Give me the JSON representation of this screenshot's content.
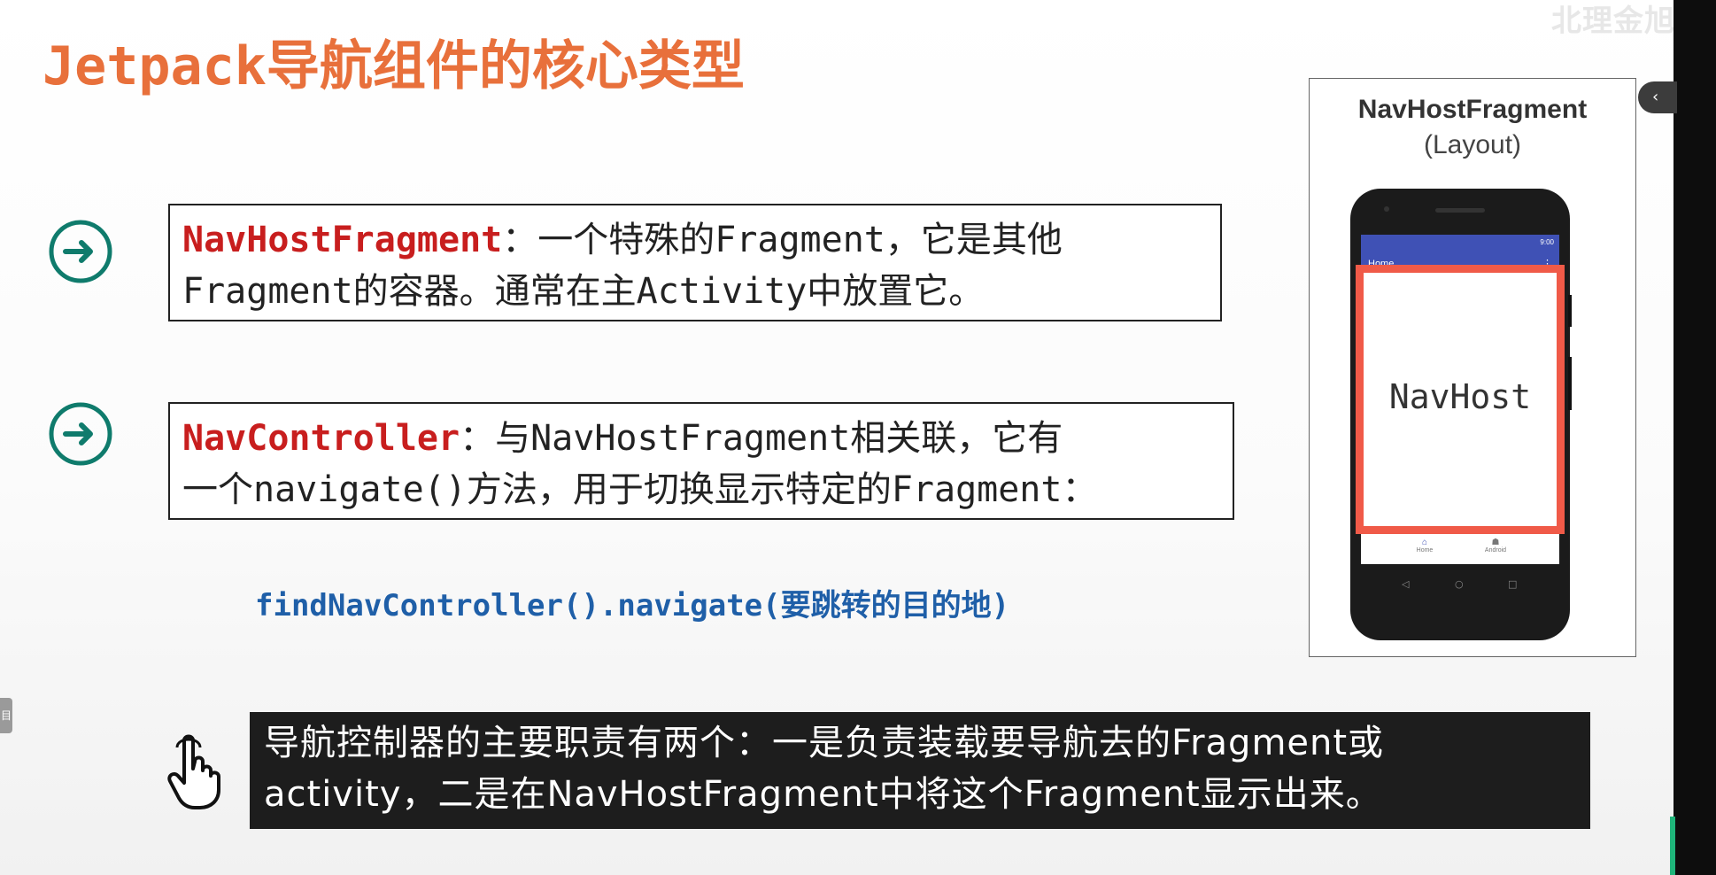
{
  "watermark": "北理金旭亮",
  "title": {
    "latin": "Jetpack",
    "chinese": "导航组件的核心类型"
  },
  "items": [
    {
      "term": "NavHostFragment",
      "line1_rest": "：一个特殊的Fragment，它是其他",
      "line2": "Fragment的容器。通常在主Activity中放置它。"
    },
    {
      "term": "NavController",
      "line1_rest": "：与NavHostFragment相关联，它有",
      "line2": "一个navigate()方法，用于切换显示特定的Fragment："
    }
  ],
  "code": "findNavController().navigate(要跳转的目的地)",
  "caption": {
    "line1": "导航控制器的主要职责有两个：一是负责装载要导航去的Fragment或",
    "line2": "activity，二是在NavHostFragment中将这个Fragment显示出来。"
  },
  "phone": {
    "title": "NavHostFragment",
    "subtitle": "(Layout)",
    "app_bar_title": "Home",
    "status_time": "9:00",
    "navhost_label": "NavHost",
    "bottom_nav": [
      "Home",
      "Android"
    ]
  },
  "controls": {
    "collapse_glyph": "‹",
    "left_tab_glyph": "目"
  },
  "colors": {
    "title": "#e8703b",
    "term": "#c81e1e",
    "code": "#1f5fa8",
    "arrow": "#0f7b6c",
    "caption_bg": "#1d1d1d",
    "navhost_border": "#f05a48",
    "app_bar": "#3f51b5"
  }
}
